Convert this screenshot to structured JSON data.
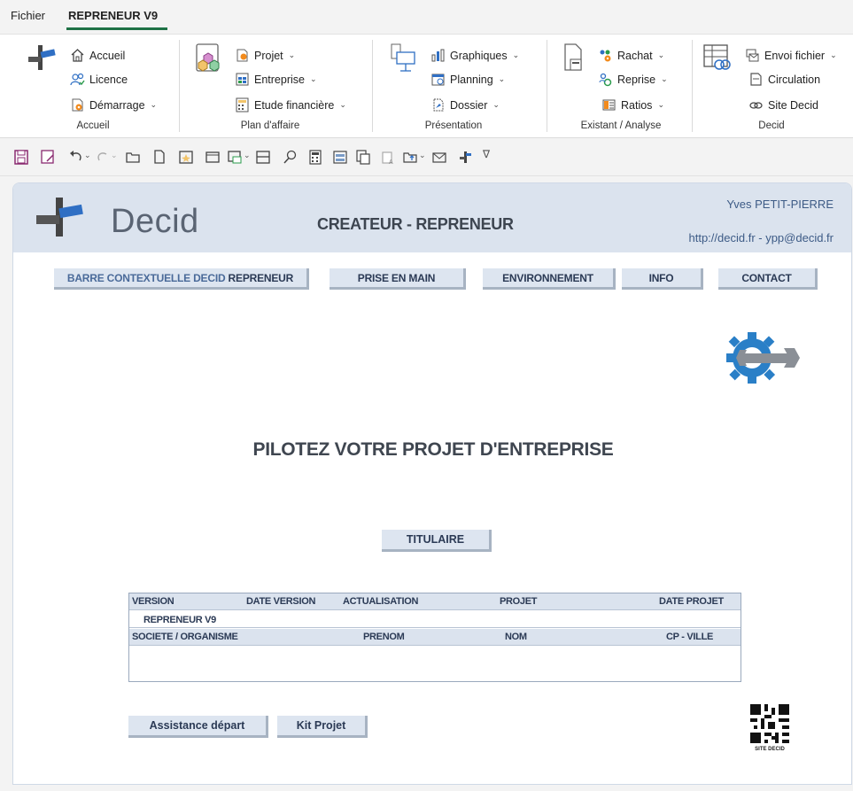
{
  "ribbon_tabs": [
    {
      "label": "Fichier",
      "active": false
    },
    {
      "label": "REPRENEUR V9",
      "active": true
    }
  ],
  "ribbon": {
    "groups": [
      {
        "label": "Accueil",
        "items": [
          {
            "label": "Accueil",
            "icon": "home-icon",
            "dropdown": false
          },
          {
            "label": "Licence",
            "icon": "users-icon",
            "dropdown": false
          },
          {
            "label": "Démarrage",
            "icon": "start-icon",
            "dropdown": true
          }
        ]
      },
      {
        "label": "Plan d'affaire",
        "items": [
          {
            "label": "Projet",
            "icon": "project-icon",
            "dropdown": true
          },
          {
            "label": "Entreprise",
            "icon": "company-icon",
            "dropdown": true
          },
          {
            "label": "Etude financière",
            "icon": "calculator-icon",
            "dropdown": true
          }
        ]
      },
      {
        "label": "Présentation",
        "items": [
          {
            "label": "Graphiques",
            "icon": "bar-chart-icon",
            "dropdown": true
          },
          {
            "label": "Planning",
            "icon": "calendar-icon",
            "dropdown": true
          },
          {
            "label": "Dossier",
            "icon": "document-icon",
            "dropdown": true
          }
        ]
      },
      {
        "label": "Existant / Analyse",
        "items": [
          {
            "label": "Rachat",
            "icon": "people-gear-icon",
            "dropdown": true
          },
          {
            "label": "Reprise",
            "icon": "people-sync-icon",
            "dropdown": true
          },
          {
            "label": "Ratios",
            "icon": "ratios-icon",
            "dropdown": true
          }
        ]
      },
      {
        "label": "Decid",
        "items": [
          {
            "label": "Envoi fichier",
            "icon": "send-file-icon",
            "dropdown": true
          },
          {
            "label": "Circulation",
            "icon": "page-icon",
            "dropdown": false
          },
          {
            "label": "Site Decid",
            "icon": "link-icon",
            "dropdown": false
          }
        ]
      }
    ]
  },
  "qat_icons": [
    "save-icon",
    "save-as-icon",
    "undo-icon",
    "redo-icon",
    "open-folder-icon",
    "new-file-icon",
    "star-file-icon",
    "window-icon",
    "window-send-icon",
    "table-icon",
    "search-icon",
    "calculator-icon",
    "form-icon",
    "copy-icon",
    "paste-format-icon",
    "export-icon",
    "mail-icon",
    "decid-logo-icon",
    "customize-icon"
  ],
  "header": {
    "brand": "Decid",
    "title": "CREATEUR - REPRENEUR",
    "user": "Yves PETIT-PIERRE",
    "contact": "http://decid.fr  - ypp@decid.fr"
  },
  "nav": [
    {
      "label_dim": "BARRE CONTEXTUELLE DECID",
      "label": " REPRENEUR"
    },
    {
      "label": "PRISE EN MAIN"
    },
    {
      "label": "ENVIRONNEMENT"
    },
    {
      "label": "INFO"
    },
    {
      "label": "CONTACT"
    }
  ],
  "headline": "PILOTEZ VOTRE PROJET D'ENTREPRISE",
  "titulaire_button": "TITULAIRE",
  "table": {
    "row1_headers": [
      "VERSION",
      "DATE VERSION",
      "ACTUALISATION",
      "PROJET",
      "DATE PROJET"
    ],
    "row1_values": [
      "REPRENEUR V9",
      "",
      "",
      "",
      ""
    ],
    "row2_headers": [
      "SOCIETE / ORGANISME",
      "PRENOM",
      "NOM",
      "CP - VILLE"
    ],
    "row2_values": [
      "",
      "",
      "",
      ""
    ]
  },
  "buttons": {
    "assistance": "Assistance départ",
    "kit": "Kit Projet"
  },
  "qr_caption": "SITE DECID",
  "colors": {
    "accent_green": "#1e7145",
    "header_bg": "#dbe3ee",
    "button_bg": "#dde5f0",
    "text_navy": "#2b3a55",
    "gear_blue": "#2a7fc7"
  }
}
